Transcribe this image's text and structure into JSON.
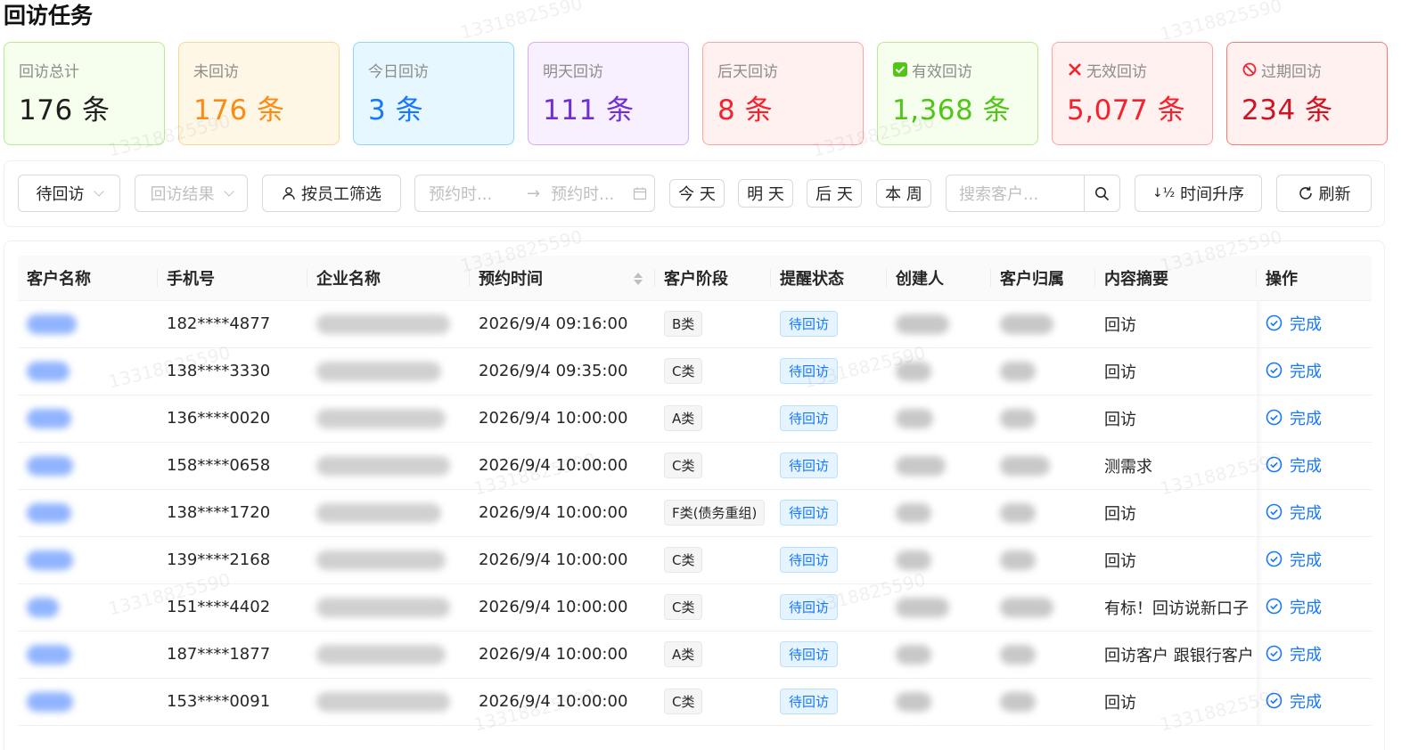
{
  "page_title": "回访任务",
  "stats": [
    {
      "label": "回访总计",
      "value": "176 条",
      "icon": "",
      "color": "#1f1f1f",
      "bg": "#f6ffed",
      "border": "#b7eb8f"
    },
    {
      "label": "未回访",
      "value": "176 条",
      "icon": "",
      "color": "#fa8c16",
      "bg": "#fff7e6",
      "border": "#ffd591"
    },
    {
      "label": "今日回访",
      "value": "3 条",
      "icon": "",
      "color": "#1677ff",
      "bg": "#e6f7ff",
      "border": "#91d5ff"
    },
    {
      "label": "明天回访",
      "value": "111 条",
      "icon": "",
      "color": "#722ed1",
      "bg": "#f9f0ff",
      "border": "#d3adf7"
    },
    {
      "label": "后天回访",
      "value": "8 条",
      "icon": "",
      "color": "#f5222d",
      "bg": "#fff1f0",
      "border": "#ffa39e"
    },
    {
      "label": "有效回访",
      "value": "1,368 条",
      "icon": "check-box-icon",
      "color": "#52c41a",
      "bg": "#f6ffed",
      "border": "#b7eb8f"
    },
    {
      "label": "无效回访",
      "value": "5,077 条",
      "icon": "cross-icon",
      "color": "#f5222d",
      "bg": "#fff1f0",
      "border": "#ffa39e"
    },
    {
      "label": "过期回访",
      "value": "234 条",
      "icon": "prohibited-icon",
      "color": "#cf1322",
      "bg": "#fff1f0",
      "border": "#ff7875"
    }
  ],
  "filters": {
    "status": "待回访",
    "result_placeholder": "回访结果",
    "employee_filter": "按员工筛选",
    "date_start_placeholder": "预约时...",
    "date_end_placeholder": "预约时...",
    "today": "今 天",
    "tomorrow": "明 天",
    "day_after": "后 天",
    "this_week": "本 周",
    "search_placeholder": "搜索客户...",
    "sort_label": "时间升序",
    "refresh_label": "刷新"
  },
  "table": {
    "columns": [
      "客户名称",
      "手机号",
      "企业名称",
      "预约时间",
      "客户阶段",
      "提醒状态",
      "创建人",
      "客户归属",
      "内容摘要",
      "操作"
    ],
    "rows": [
      {
        "phone": "182****4877",
        "time": "2026/9/4 09:16:00",
        "stage": "B类",
        "remind": "待回访",
        "summary": "回访",
        "action": "完成"
      },
      {
        "phone": "138****3330",
        "time": "2026/9/4 09:35:00",
        "stage": "C类",
        "remind": "待回访",
        "summary": "回访",
        "action": "完成"
      },
      {
        "phone": "136****0020",
        "time": "2026/9/4 10:00:00",
        "stage": "A类",
        "remind": "待回访",
        "summary": "回访",
        "action": "完成"
      },
      {
        "phone": "158****0658",
        "time": "2026/9/4 10:00:00",
        "stage": "C类",
        "remind": "待回访",
        "summary": "测需求",
        "action": "完成"
      },
      {
        "phone": "138****1720",
        "time": "2026/9/4 10:00:00",
        "stage": "F类(债务重组)",
        "remind": "待回访",
        "summary": "回访",
        "action": "完成"
      },
      {
        "phone": "139****2168",
        "time": "2026/9/4 10:00:00",
        "stage": "C类",
        "remind": "待回访",
        "summary": "回访",
        "action": "完成"
      },
      {
        "phone": "151****4402",
        "time": "2026/9/4 10:00:00",
        "stage": "C类",
        "remind": "待回访",
        "summary": "有标！回访说新口子",
        "action": "完成"
      },
      {
        "phone": "187****1877",
        "time": "2026/9/4 10:00:00",
        "stage": "A类",
        "remind": "待回访",
        "summary": "回访客户 跟银行客户",
        "action": "完成"
      },
      {
        "phone": "153****0091",
        "time": "2026/9/4 10:00:00",
        "stage": "C类",
        "remind": "待回访",
        "summary": "回访",
        "action": "完成"
      }
    ]
  },
  "watermark": "13318825590"
}
